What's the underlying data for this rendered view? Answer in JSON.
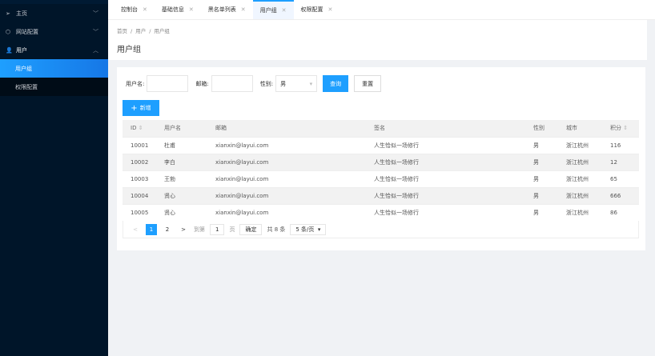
{
  "sidebar": {
    "items": [
      {
        "icon": "send-icon",
        "label": "主页",
        "expanded": false
      },
      {
        "icon": "cube-icon",
        "label": "网站配置",
        "expanded": false
      },
      {
        "icon": "user-icon",
        "label": "用户",
        "expanded": true,
        "children": [
          {
            "label": "用户组",
            "active": true
          },
          {
            "label": "权限配置",
            "active": false
          }
        ]
      }
    ]
  },
  "tabs": [
    {
      "label": "控制台"
    },
    {
      "label": "基础信息"
    },
    {
      "label": "黑名单列表"
    },
    {
      "label": "用户组",
      "active": true
    },
    {
      "label": "权限配置"
    }
  ],
  "breadcrumb": [
    "首页",
    "/",
    "用户",
    "/",
    "用户组"
  ],
  "page_title": "用户组",
  "form": {
    "username_label": "用户名:",
    "username_value": "",
    "email_label": "邮箱:",
    "email_value": "",
    "gender_label": "性别:",
    "gender_value": "男",
    "search_label": "查询",
    "reset_label": "重置"
  },
  "add_label": "新增",
  "table": {
    "headers": [
      "ID",
      "用户名",
      "邮箱",
      "签名",
      "性别",
      "城市",
      "积分"
    ],
    "rows": [
      [
        "10001",
        "杜甫",
        "xianxin@layui.com",
        "人生恰似一场修行",
        "男",
        "浙江杭州",
        "116"
      ],
      [
        "10002",
        "李白",
        "xianxin@layui.com",
        "人生恰似一场修行",
        "男",
        "浙江杭州",
        "12"
      ],
      [
        "10003",
        "王勃",
        "xianxin@layui.com",
        "人生恰似一场修行",
        "男",
        "浙江杭州",
        "65"
      ],
      [
        "10004",
        "贤心",
        "xianxin@layui.com",
        "人生恰似一场修行",
        "男",
        "浙江杭州",
        "666"
      ],
      [
        "10005",
        "贤心",
        "xianxin@layui.com",
        "人生恰似一场修行",
        "男",
        "浙江杭州",
        "86"
      ]
    ]
  },
  "pager": {
    "prev": "<",
    "pages": [
      "1",
      "2"
    ],
    "current": "1",
    "next": ">",
    "goto_label": "到第",
    "goto_value": "1",
    "page_unit": "页",
    "confirm": "确定",
    "total": "共 8 条",
    "page_size": "5 条/页"
  }
}
